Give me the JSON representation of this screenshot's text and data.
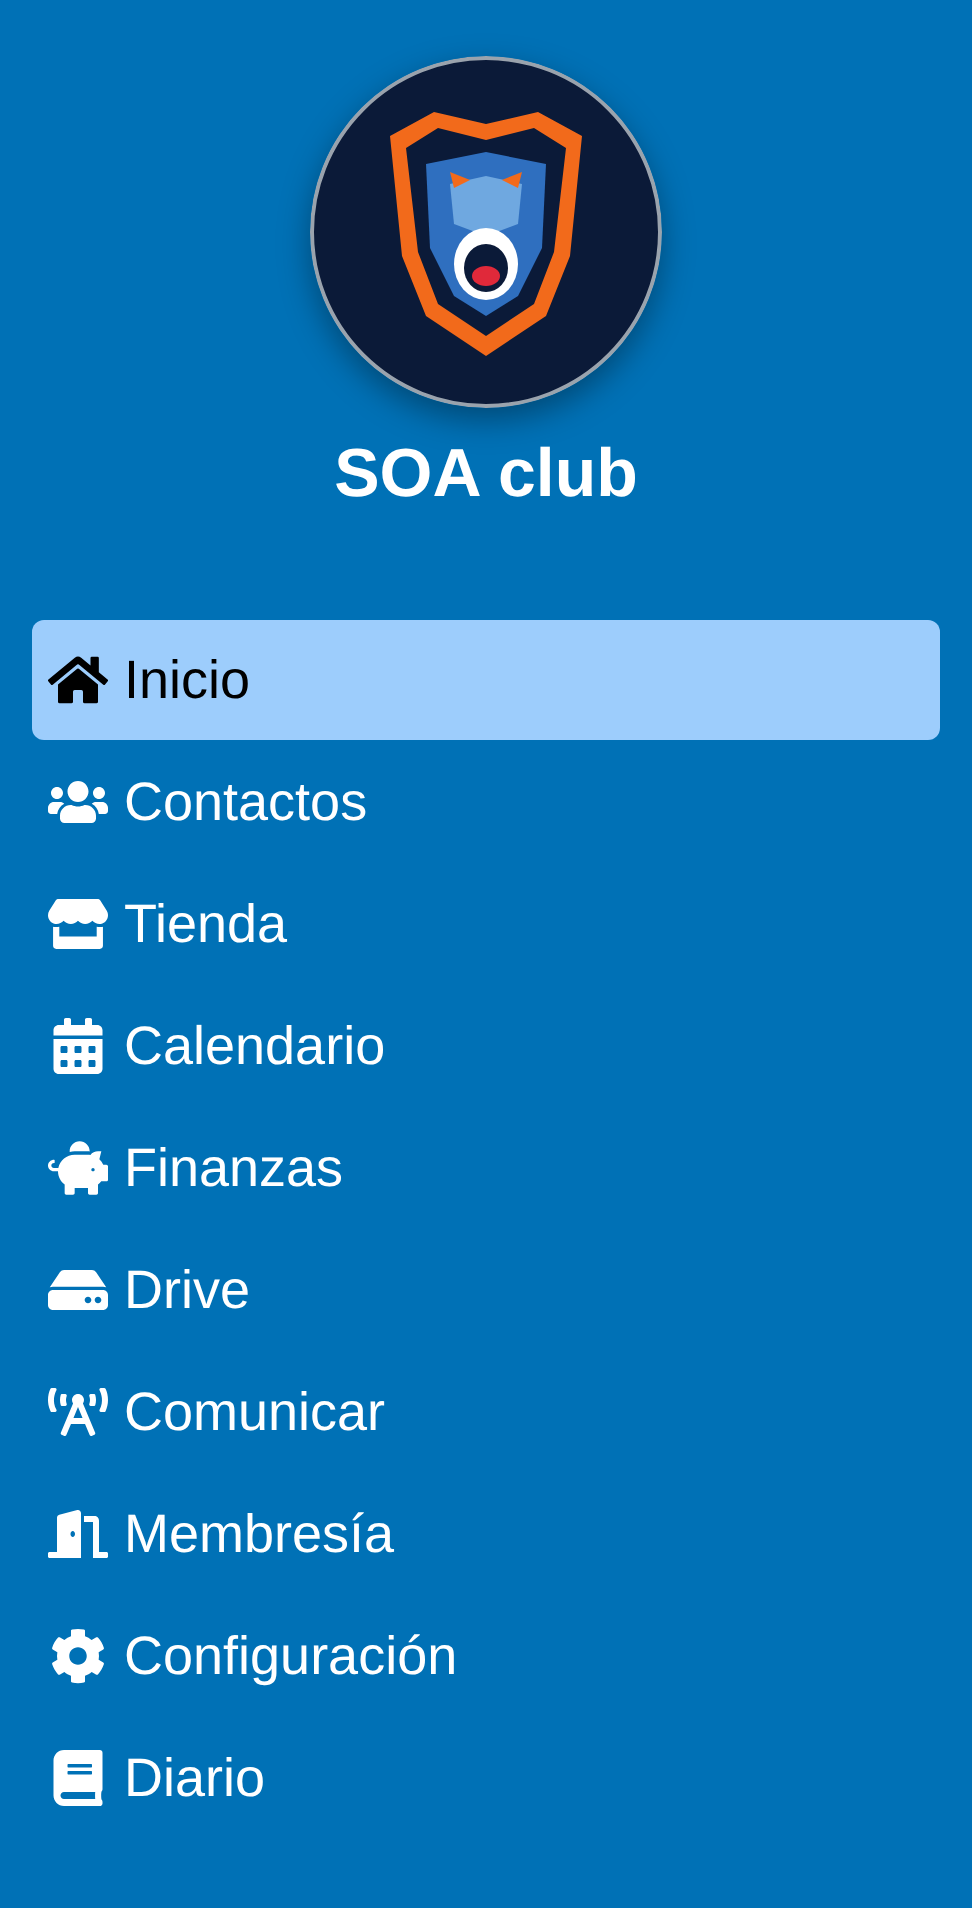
{
  "club": {
    "name": "SOA club"
  },
  "nav": [
    {
      "label": "Inicio",
      "selected": true
    },
    {
      "label": "Contactos",
      "selected": false
    },
    {
      "label": "Tienda",
      "selected": false
    },
    {
      "label": "Calendario",
      "selected": false
    },
    {
      "label": "Finanzas",
      "selected": false
    },
    {
      "label": "Drive",
      "selected": false
    },
    {
      "label": "Comunicar",
      "selected": false
    },
    {
      "label": "Membresía",
      "selected": false
    },
    {
      "label": "Configuración",
      "selected": false
    },
    {
      "label": "Diario",
      "selected": false
    }
  ]
}
